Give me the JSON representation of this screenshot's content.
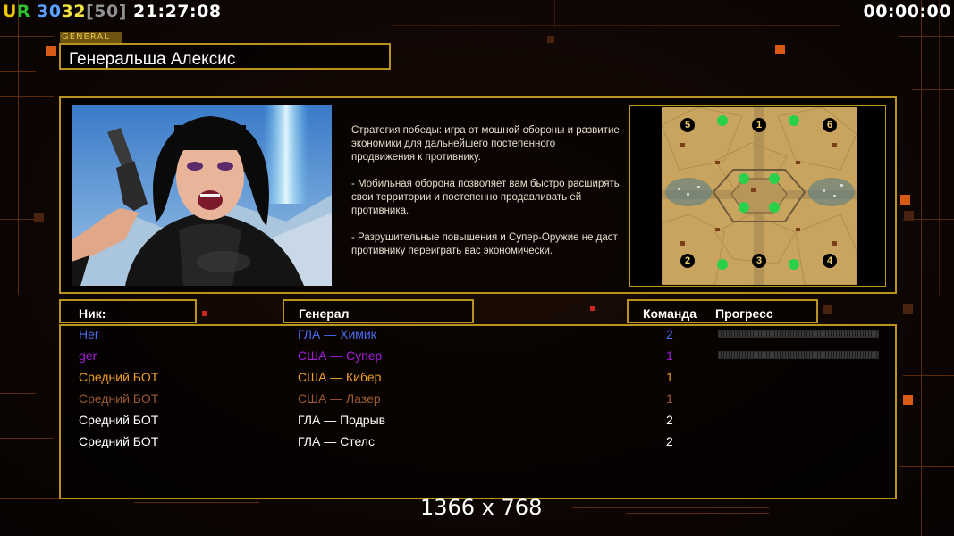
{
  "hud": {
    "ur": "UR",
    "fps1": "30",
    "fps2": "32",
    "fps_cap": "[50]",
    "clock": "21:27:08",
    "timer": "00:00:00"
  },
  "general_tag": "GENERAL",
  "general_name": "Генеральша Алексис",
  "description": [
    "Стратегия победы: игра от мощной обороны и развитие экономики для дальнейшего постепенного продвижения к противнику.",
    "- Мобильная оборона позволяет вам быстро расширять свои территории и постепенно продавливать ей противника.",
    "- Разрушительные повышения и Супер-Оружие не даст противнику переиграть вас экономически."
  ],
  "map": {
    "start_positions": [
      "5",
      "1",
      "6",
      "2",
      "3",
      "4"
    ]
  },
  "columns": {
    "nick": "Ник:",
    "general": "Генерал",
    "team": "Команда",
    "progress": "Прогресс"
  },
  "players": [
    {
      "nick": "Her",
      "general": "ГЛА — Химик",
      "team": "2",
      "color": "#4a6cf0",
      "progress_bar": true
    },
    {
      "nick": "ger",
      "general": "США — Супер",
      "team": "1",
      "color": "#a020d8",
      "progress_bar": true
    },
    {
      "nick": "Средний БОТ",
      "general": "США — Кибер",
      "team": "1",
      "color": "#f0a028",
      "progress_bar": false
    },
    {
      "nick": "Средний БОТ",
      "general": "США — Лазер",
      "team": "1",
      "color": "#9a5a34",
      "progress_bar": false
    },
    {
      "nick": "Средний БОТ",
      "general": "ГЛА — Подрыв",
      "team": "2",
      "color": "#ffffff",
      "progress_bar": false
    },
    {
      "nick": "Средний БОТ",
      "general": "ГЛА — Стелс",
      "team": "2",
      "color": "#ffffff",
      "progress_bar": false
    }
  ],
  "resolution": "1366 x 768",
  "colors": {
    "frame_gold": "#b8941e",
    "accent_orange": "#d85a14",
    "hud_ur_yellow": "#f0c800",
    "hud_ur_green": "#30c030",
    "hud_fps_blue": "#5aa0ff",
    "hud_fps_yellow": "#f0e040",
    "hud_cap_grey": "#909090"
  }
}
